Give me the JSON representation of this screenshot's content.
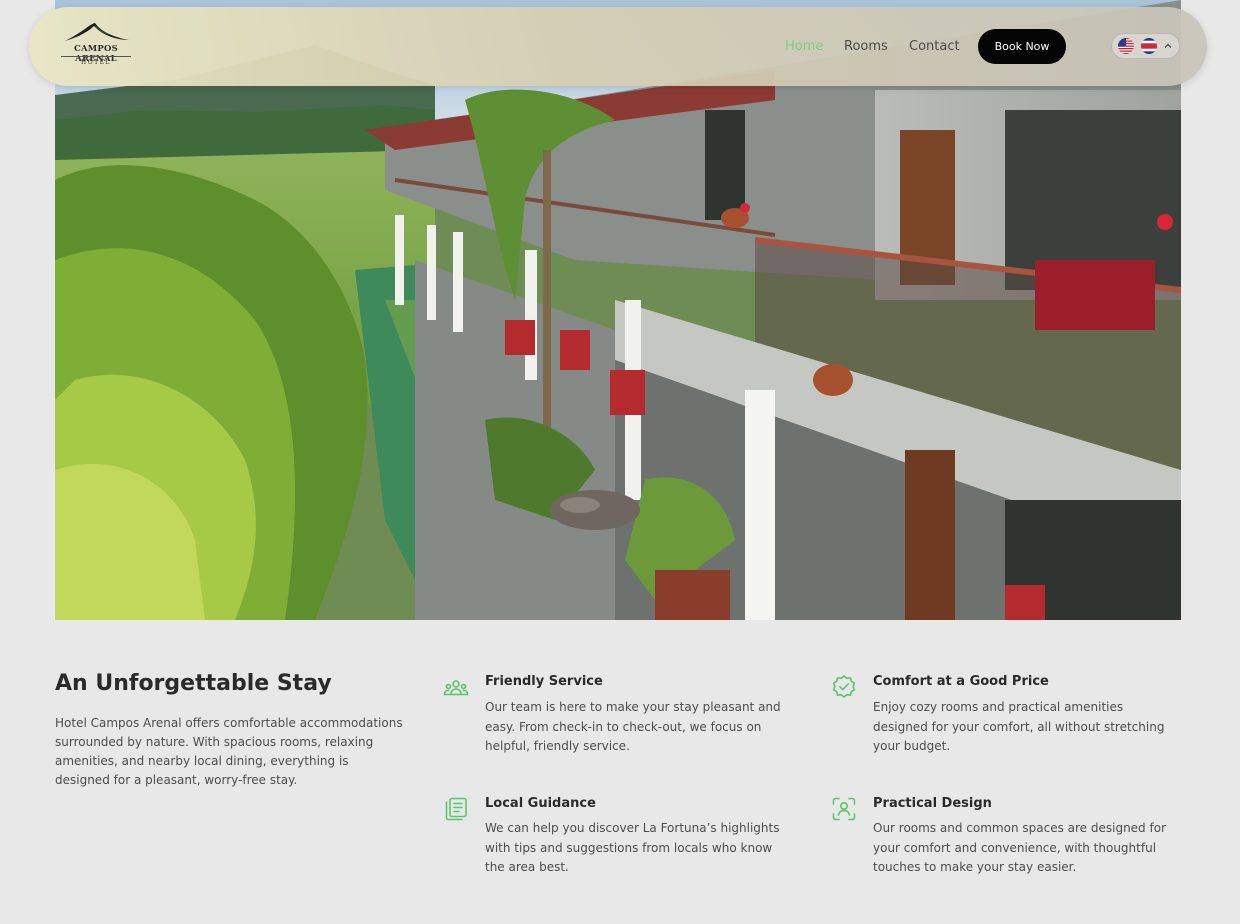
{
  "brand": {
    "logo_name": "CAMPOS ARENAL",
    "logo_sub": "HOTEL"
  },
  "nav": {
    "links": [
      {
        "label": "Home",
        "active": true
      },
      {
        "label": "Rooms",
        "active": false
      },
      {
        "label": "Contact",
        "active": false
      }
    ],
    "book_label": "Book Now",
    "languages": [
      "us-flag-icon",
      "costa-rica-flag-icon"
    ],
    "active_color": "#7ecf86"
  },
  "intro": {
    "title": "An Unforgettable Stay",
    "text": "Hotel Campos Arenal offers comfortable accommodations surrounded by nature. With spacious rooms, relaxing amenities, and nearby local dining, everything is designed for a pleasant, worry-free stay."
  },
  "features": [
    {
      "icon": "people-icon",
      "title": "Friendly Service",
      "text": "Our team is here to make your stay pleasant and easy. From check-in to check-out, we focus on helpful, friendly service."
    },
    {
      "icon": "badge-check-icon",
      "title": "Comfort at a Good Price",
      "text": "Enjoy cozy rooms and practical amenities designed for your comfort, all without stretching your budget."
    },
    {
      "icon": "guide-book-icon",
      "title": "Local Guidance",
      "text": "We can help you discover La Fortuna’s highlights with tips and suggestions from locals who know the area best."
    },
    {
      "icon": "user-focus-icon",
      "title": "Practical Design",
      "text": "Our rooms and common spaces are designed for your comfort and convenience, with thoughtful touches to make your stay easier."
    }
  ],
  "colors": {
    "accent": "#5cc46a",
    "button": "#050505",
    "background": "#e8e8e8"
  }
}
